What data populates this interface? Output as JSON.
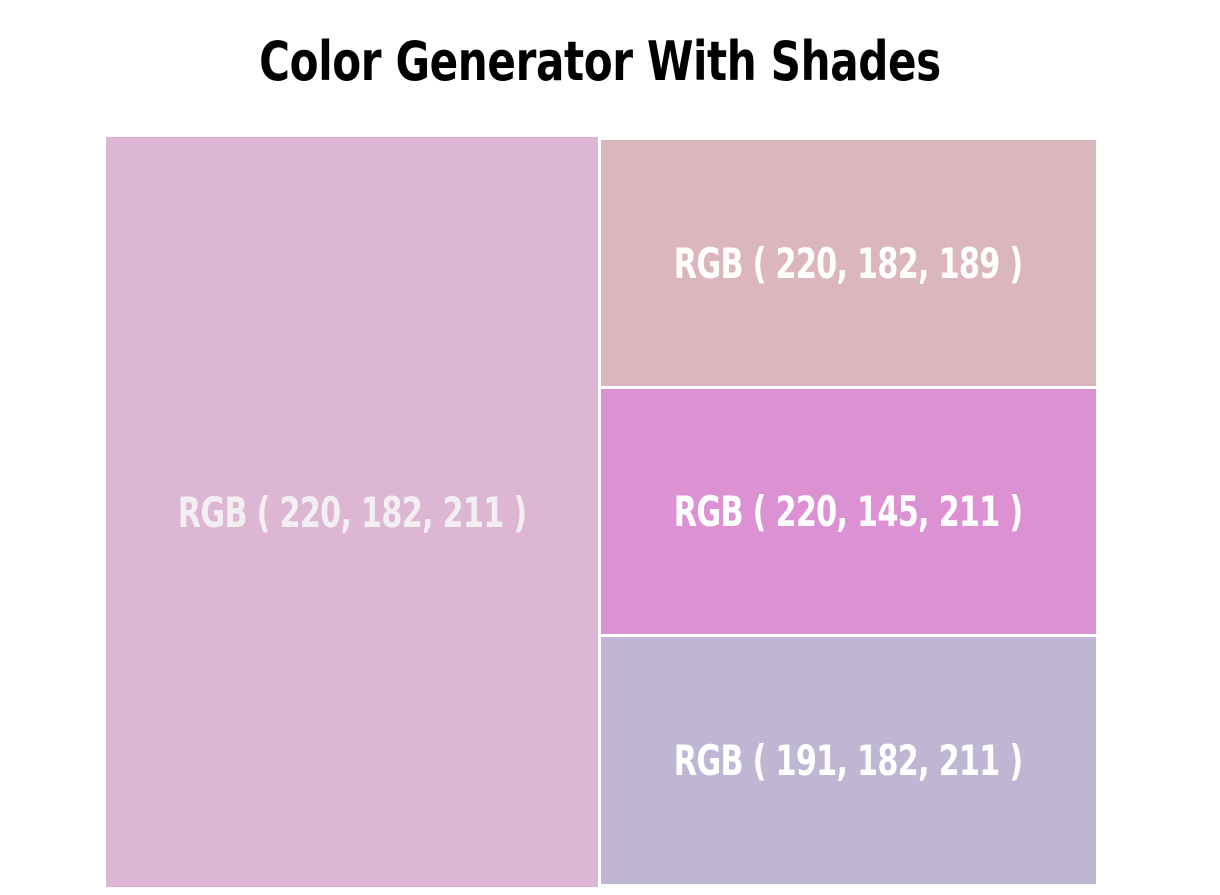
{
  "header": {
    "title": "Color Generator With Shades"
  },
  "swatches": {
    "main": {
      "label": "RGB ( 220, 182, 211 )",
      "color": "#dcb6d3"
    },
    "shade1": {
      "label": "RGB ( 220, 182, 189 )",
      "color": "#dcb6bd"
    },
    "shade2": {
      "label": "RGB ( 220, 145, 211 )",
      "color": "#dc91d3"
    },
    "shade3": {
      "label": "RGB ( 191, 182, 211 )",
      "color": "#bfb6d3"
    }
  }
}
